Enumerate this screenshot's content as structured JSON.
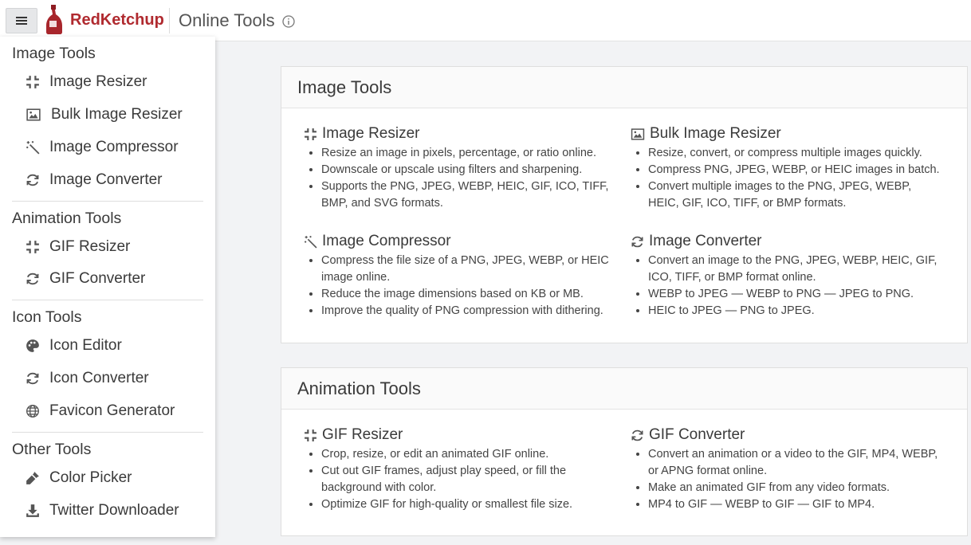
{
  "header": {
    "brand": "RedKetchup",
    "title": "Online Tools"
  },
  "colors": {
    "brand": "#b02a2f",
    "accent_bg": "#e6e7e9"
  },
  "sidebar": {
    "sections": [
      {
        "title": "Image Tools",
        "items": [
          {
            "label": "Image Resizer",
            "icon": "resize-icon"
          },
          {
            "label": "Bulk Image Resizer",
            "icon": "image-icon"
          },
          {
            "label": "Image Compressor",
            "icon": "magic-wand-icon"
          },
          {
            "label": "Image Converter",
            "icon": "refresh-icon"
          }
        ]
      },
      {
        "title": "Animation Tools",
        "items": [
          {
            "label": "GIF Resizer",
            "icon": "resize-icon"
          },
          {
            "label": "GIF Converter",
            "icon": "refresh-icon"
          }
        ]
      },
      {
        "title": "Icon Tools",
        "items": [
          {
            "label": "Icon Editor",
            "icon": "palette-icon"
          },
          {
            "label": "Icon Converter",
            "icon": "refresh-icon"
          },
          {
            "label": "Favicon Generator",
            "icon": "globe-icon"
          }
        ]
      },
      {
        "title": "Other Tools",
        "items": [
          {
            "label": "Color Picker",
            "icon": "eyedropper-icon"
          },
          {
            "label": "Twitter Downloader",
            "icon": "download-icon"
          }
        ]
      }
    ]
  },
  "main": {
    "cards": [
      {
        "title": "Image Tools",
        "tools": [
          {
            "title": "Image Resizer",
            "icon": "resize-icon",
            "bullets": [
              "Resize an image in pixels, percentage, or ratio online.",
              "Downscale or upscale using filters and sharpening.",
              "Supports the PNG, JPEG, WEBP, HEIC, GIF, ICO, TIFF, BMP, and SVG formats."
            ]
          },
          {
            "title": "Bulk Image Resizer",
            "icon": "image-icon",
            "bullets": [
              "Resize, convert, or compress multiple images quickly.",
              "Compress PNG, JPEG, WEBP, or HEIC images in batch.",
              "Convert multiple images to the PNG, JPEG, WEBP, HEIC, GIF, ICO, TIFF, or BMP formats."
            ]
          },
          {
            "title": "Image Compressor",
            "icon": "magic-wand-icon",
            "bullets": [
              "Compress the file size of a PNG, JPEG, WEBP, or HEIC image online.",
              "Reduce the image dimensions based on KB or MB.",
              "Improve the quality of PNG compression with dithering."
            ]
          },
          {
            "title": "Image Converter",
            "icon": "refresh-icon",
            "bullets": [
              "Convert an image to the PNG, JPEG, WEBP, HEIC, GIF, ICO, TIFF, or BMP format online.",
              "WEBP to JPEG — WEBP to PNG — JPEG to PNG.",
              "HEIC to JPEG — PNG to JPEG."
            ]
          }
        ]
      },
      {
        "title": "Animation Tools",
        "tools": [
          {
            "title": "GIF Resizer",
            "icon": "resize-icon",
            "bullets": [
              "Crop, resize, or edit an animated GIF online.",
              "Cut out GIF frames, adjust play speed, or fill the background with color.",
              "Optimize GIF for high-quality or smallest file size."
            ]
          },
          {
            "title": "GIF Converter",
            "icon": "refresh-icon",
            "bullets": [
              "Convert an animation or a video to the GIF, MP4, WEBP, or APNG format online.",
              "Make an animated GIF from any video formats.",
              "MP4 to GIF — WEBP to GIF — GIF to MP4."
            ]
          }
        ]
      }
    ]
  }
}
